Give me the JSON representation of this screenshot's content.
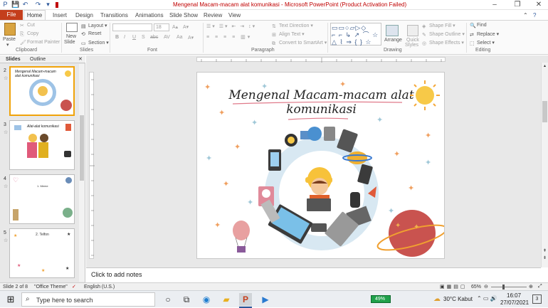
{
  "window": {
    "title": "Mengenal Macam-macam alat komunikasi  -  Microsoft PowerPoint (Product Activation Failed)",
    "controls": [
      "–",
      "❐",
      "✕"
    ]
  },
  "ribbon_tabs": [
    "File",
    "Home",
    "Insert",
    "Design",
    "Transitions",
    "Animations",
    "Slide Show",
    "Review",
    "View"
  ],
  "ribbon": {
    "clipboard": {
      "paste": "Paste",
      "cut": "Cut",
      "copy": "Copy",
      "format_painter": "Format Painter",
      "label": "Clipboard"
    },
    "slides": {
      "new_slide": "New",
      "new_slide2": "Slide",
      "layout": "Layout",
      "reset": "Reset",
      "section": "Section",
      "label": "Slides"
    },
    "font": {
      "size": "18",
      "bold": "B",
      "italic": "I",
      "underline": "U",
      "shadow": "S",
      "strike": "abc",
      "spacing": "AV",
      "case": "Aa",
      "label": "Font"
    },
    "paragraph": {
      "text_direction": "Text Direction",
      "align_text": "Align Text",
      "smartart": "Convert to SmartArt",
      "label": "Paragraph"
    },
    "drawing": {
      "arrange": "Arrange",
      "quick_styles": "Quick",
      "quick_styles2": "Styles",
      "shape_fill": "Shape Fill",
      "shape_outline": "Shape Outline",
      "shape_effects": "Shape Effects",
      "label": "Drawing"
    },
    "editing": {
      "find": "Find",
      "replace": "Replace",
      "select": "Select",
      "label": "Editing"
    }
  },
  "panel_tabs": {
    "slides": "Slides",
    "outline": "Outline",
    "close": "✕"
  },
  "thumbnails": [
    {
      "num": "2",
      "title": "Mengenal Macam-macam alat komunikasi",
      "selected": true
    },
    {
      "num": "3",
      "title": "Alat-alat komunikasi",
      "selected": false
    },
    {
      "num": "4",
      "title": "1. Meme",
      "selected": false
    },
    {
      "num": "5",
      "title": "2. Telfon",
      "selected": false
    }
  ],
  "slide": {
    "title_line1": "Mengenal Macam-macam alat",
    "title_line2": "komunikasi"
  },
  "notes_placeholder": "Click to add notes",
  "status": {
    "slide_info": "Slide 2 of 8",
    "theme": "\"Office Theme\"",
    "language": "English (U.S.)",
    "zoom": "65%"
  },
  "taskbar": {
    "search_placeholder": "Type here to search",
    "battery": "49%",
    "weather": "30°C  Kabut",
    "time": "16:07",
    "date": "27/07/2021",
    "notifications": "3"
  },
  "colors": {
    "file_tab": "#c43e1c",
    "accent": "#2b579a",
    "selected_thumb": "#f0a30a",
    "title_red": "#c00000"
  }
}
